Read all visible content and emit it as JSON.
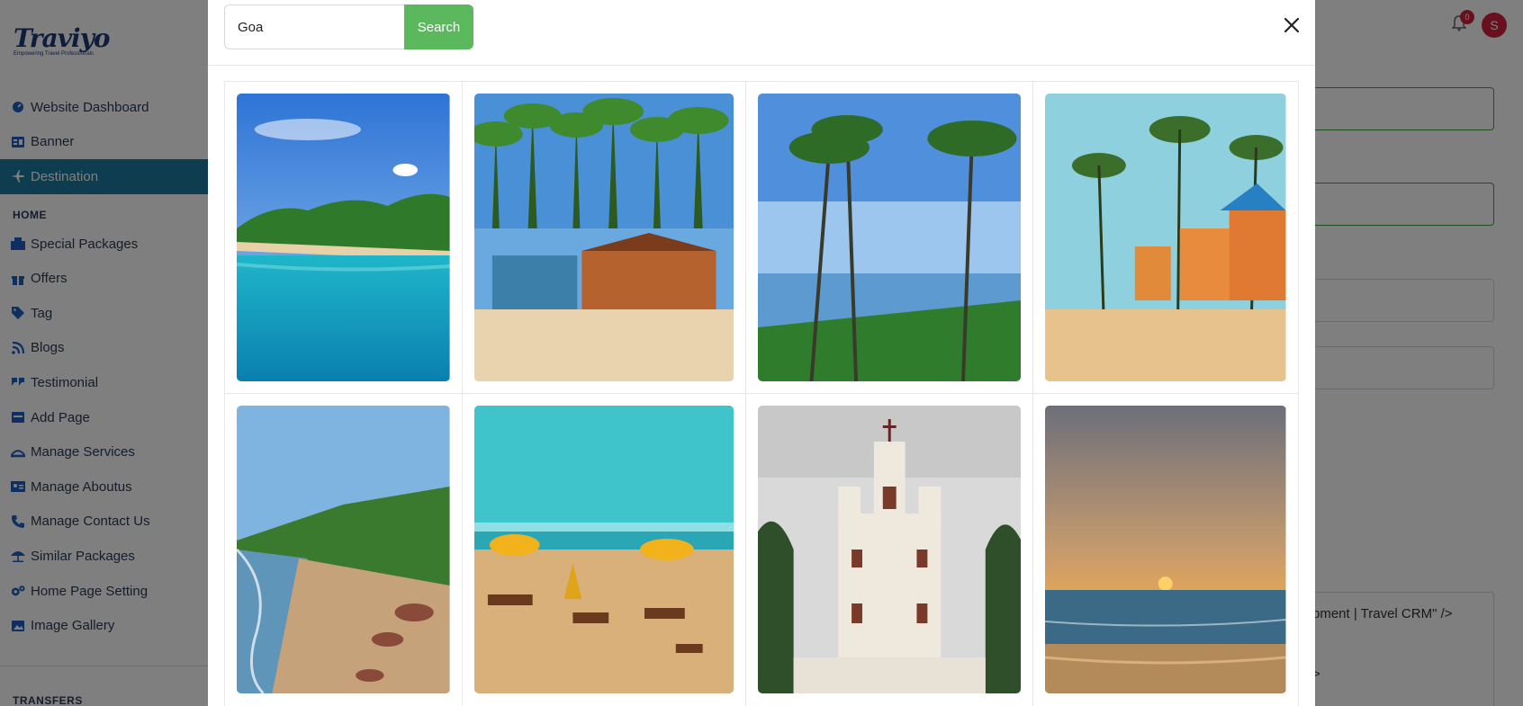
{
  "logo": {
    "name": "Traviyo",
    "tagline": "Empowering Travel Professionals"
  },
  "sidebar": {
    "top_items": [
      {
        "label": "Website Dashboard",
        "icon": "dashboard-icon"
      },
      {
        "label": "Banner",
        "icon": "banner-icon"
      },
      {
        "label": "Destination",
        "icon": "plane-icon",
        "active": true
      }
    ],
    "section_home": "HOME",
    "home_items": [
      {
        "label": "Special Packages",
        "icon": "building-icon"
      },
      {
        "label": "Offers",
        "icon": "gift-icon"
      },
      {
        "label": "Tag",
        "icon": "tag-icon"
      },
      {
        "label": "Blogs",
        "icon": "blog-icon"
      },
      {
        "label": "Testimonial",
        "icon": "quote-icon"
      },
      {
        "label": "Add Page",
        "icon": "page-icon"
      },
      {
        "label": "Manage Services",
        "icon": "services-icon"
      },
      {
        "label": "Manage Aboutus",
        "icon": "id-card-icon"
      },
      {
        "label": "Manage Contact Us",
        "icon": "phone-icon"
      },
      {
        "label": "Similar Packages",
        "icon": "umbrella-icon"
      },
      {
        "label": "Home Page Setting",
        "icon": "cogs-icon"
      },
      {
        "label": "Image Gallery",
        "icon": "image-icon"
      }
    ],
    "section_transfers": "TRANSFERS"
  },
  "header": {
    "notification_count": "0",
    "avatar_initial": "S"
  },
  "background": {
    "snippet_line1": "pment | Travel CRM\" />",
    "snippet_line2": ">"
  },
  "modal": {
    "search": {
      "value": "Goa",
      "button_label": "Search"
    },
    "images": [
      {
        "name": "beach-cove-image"
      },
      {
        "name": "beach-huts-image"
      },
      {
        "name": "palm-coast-image"
      },
      {
        "name": "beach-cottages-image"
      },
      {
        "name": "rocky-beach-image"
      },
      {
        "name": "umbrella-beach-image"
      },
      {
        "name": "church-image"
      },
      {
        "name": "sunset-sea-image"
      }
    ]
  },
  "colors": {
    "accent_active": "#1d7aa0",
    "search_button": "#5cb85c",
    "badge": "#d0203a",
    "icon_blue": "#1d5fbf"
  }
}
